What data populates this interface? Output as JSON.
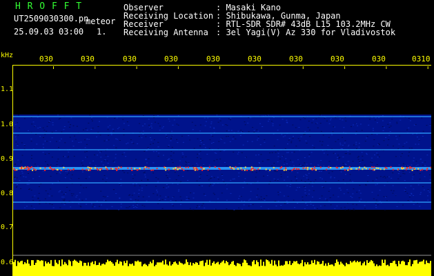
{
  "header": {
    "station": "H R O F F T",
    "filename": "UT2509030300.pn",
    "mode": "meteor",
    "datetime": "25.09.03 03:00",
    "scale": "1.",
    "observer_label": "Observer",
    "observer_value": ": Masaki Kano",
    "location_label": "Receiving Location",
    "location_value": ": Shibukawa, Gunma, Japan",
    "receiver_label": "Receiver",
    "receiver_value": ": RTL-SDR SDR# 43dB L15 103.2MHz CW",
    "antenna_label": "Receiving Antenna",
    "antenna_value": ": 3el Yagi(V) Az 330 for Vladivostok"
  },
  "axes": {
    "y_unit": "kHz",
    "y_ticks": [
      "1.1",
      "1.0",
      "0.9",
      "0.8",
      "0.7",
      "0.6"
    ],
    "x_ticks": [
      "030",
      "030",
      "030",
      "030",
      "030",
      "030",
      "030",
      "030",
      "030",
      "0310"
    ]
  },
  "colors": {
    "background": "#000000",
    "noise": "#00138c",
    "signal_line": "#2ea3ff",
    "signal_strong": "#ff2020",
    "spectrum": "#ffff00"
  }
}
